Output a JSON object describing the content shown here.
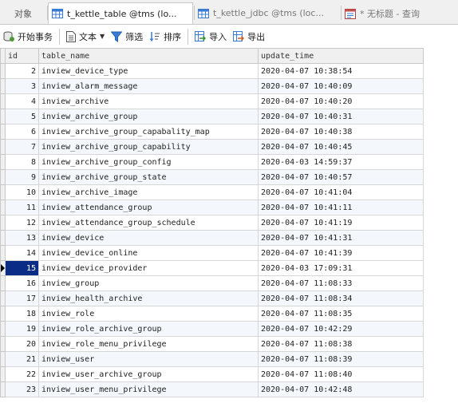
{
  "tabs": [
    {
      "label": "对象",
      "active": false
    },
    {
      "label": "t_kettle_table @tms (lo...",
      "active": true
    },
    {
      "label": "t_kettle_jdbc @tms (loc...",
      "active": false
    },
    {
      "label": "* 无标题 - 查询",
      "active": false
    }
  ],
  "toolbar": {
    "begin_transaction": "开始事务",
    "text": "文本",
    "filter": "筛选",
    "sort": "排序",
    "import": "导入",
    "export": "导出"
  },
  "grid": {
    "columns": [
      "id",
      "table_name",
      "update_time"
    ],
    "selected_row_index": 13,
    "rows": [
      {
        "id": "2",
        "table_name": "inview_device_type",
        "update_time": "2020-04-07 10:38:54"
      },
      {
        "id": "3",
        "table_name": "inview_alarm_message",
        "update_time": "2020-04-07 10:40:09"
      },
      {
        "id": "4",
        "table_name": "inview_archive",
        "update_time": "2020-04-07 10:40:20"
      },
      {
        "id": "5",
        "table_name": "inview_archive_group",
        "update_time": "2020-04-07 10:40:31"
      },
      {
        "id": "6",
        "table_name": "inview_archive_group_capabality_map",
        "update_time": "2020-04-07 10:40:38"
      },
      {
        "id": "7",
        "table_name": "inview_archive_group_capability",
        "update_time": "2020-04-07 10:40:45"
      },
      {
        "id": "8",
        "table_name": "inview_archive_group_config",
        "update_time": "2020-04-03 14:59:37"
      },
      {
        "id": "9",
        "table_name": "inview_archive_group_state",
        "update_time": "2020-04-07 10:40:57"
      },
      {
        "id": "10",
        "table_name": "inview_archive_image",
        "update_time": "2020-04-07 10:41:04"
      },
      {
        "id": "11",
        "table_name": "inview_attendance_group",
        "update_time": "2020-04-07 10:41:11"
      },
      {
        "id": "12",
        "table_name": "inview_attendance_group_schedule",
        "update_time": "2020-04-07 10:41:19"
      },
      {
        "id": "13",
        "table_name": "inview_device",
        "update_time": "2020-04-07 10:41:31"
      },
      {
        "id": "14",
        "table_name": "inview_device_online",
        "update_time": "2020-04-07 10:41:39"
      },
      {
        "id": "15",
        "table_name": "inview_device_provider",
        "update_time": "2020-04-03 17:09:31"
      },
      {
        "id": "16",
        "table_name": "inview_group",
        "update_time": "2020-04-07 11:08:33"
      },
      {
        "id": "17",
        "table_name": "inview_health_archive",
        "update_time": "2020-04-07 11:08:34"
      },
      {
        "id": "18",
        "table_name": "inview_role",
        "update_time": "2020-04-07 11:08:35"
      },
      {
        "id": "19",
        "table_name": "inview_role_archive_group",
        "update_time": "2020-04-07 10:42:29"
      },
      {
        "id": "20",
        "table_name": "inview_role_menu_privilege",
        "update_time": "2020-04-07 11:08:38"
      },
      {
        "id": "21",
        "table_name": "inview_user",
        "update_time": "2020-04-07 11:08:39"
      },
      {
        "id": "22",
        "table_name": "inview_user_archive_group",
        "update_time": "2020-04-07 11:08:40"
      },
      {
        "id": "23",
        "table_name": "inview_user_menu_privilege",
        "update_time": "2020-04-07 10:42:48"
      }
    ]
  },
  "colors": {
    "selection": "#0b2c86",
    "alt_row": "#f4f8fc",
    "tab_bar": "#f0f0f0",
    "accent_blue": "#3a7bd5"
  }
}
